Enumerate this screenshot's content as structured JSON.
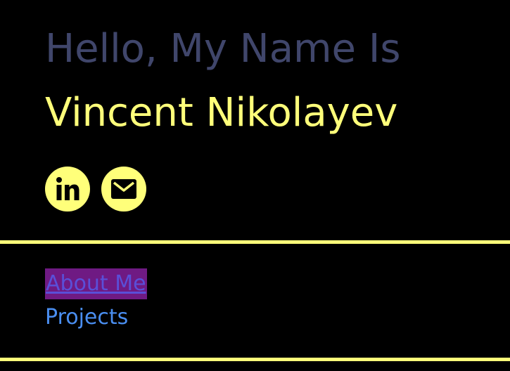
{
  "header": {
    "greeting": "Hello, My Name Is",
    "name": "Vincent Nikolayev"
  },
  "socials": [
    {
      "icon": "linkedin-icon",
      "label": "in"
    },
    {
      "icon": "mail-icon"
    }
  ],
  "nav": {
    "items": [
      {
        "label": "About Me",
        "active": true
      },
      {
        "label": "Projects",
        "active": false
      }
    ]
  },
  "colors": {
    "background": "#000000",
    "accent": "#ffff7a",
    "greeting": "#40466b",
    "link": "#4a8ef0",
    "active_highlight": "#6f1a83"
  }
}
